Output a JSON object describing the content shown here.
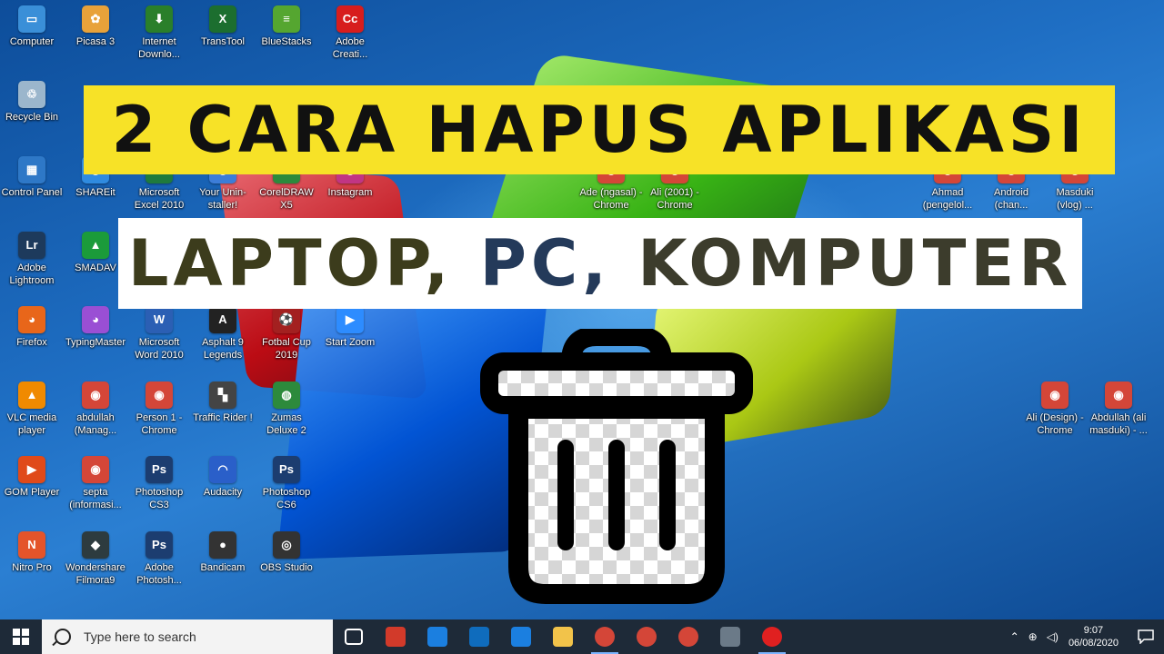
{
  "desktop_icons": [
    {
      "label": "Computer",
      "color": "#3a8fd8",
      "glyph": "▭",
      "icon": "computer-icon"
    },
    {
      "label": "Picasa 3",
      "color": "#e8a23a",
      "glyph": "✿",
      "icon": "picasa-icon"
    },
    {
      "label": "Internet Downlo...",
      "color": "#2a7f2a",
      "glyph": "⬇",
      "icon": "idm-icon"
    },
    {
      "label": "TransTool",
      "color": "#1c6e2f",
      "glyph": "X",
      "icon": "transtool-icon"
    },
    {
      "label": "BlueStacks",
      "color": "#55a630",
      "glyph": "≡",
      "icon": "bluestacks-icon"
    },
    {
      "label": "Adobe Creati...",
      "color": "#d71d1d",
      "glyph": "Cc",
      "icon": "adobe-cc-icon"
    },
    {
      "label": "Recycle Bin",
      "color": "#9bb6cc",
      "glyph": "♲",
      "icon": "recycle-bin-icon"
    },
    {
      "label": "Control Panel",
      "color": "#2e78c7",
      "glyph": "▦",
      "icon": "control-panel-icon"
    },
    {
      "label": "SHAREit",
      "color": "#2f8be0",
      "glyph": "◉",
      "icon": "shareit-icon"
    },
    {
      "label": "Microsoft Excel 2010",
      "color": "#1f7a3d",
      "glyph": "X",
      "icon": "excel-icon"
    },
    {
      "label": "Your Unin-staller!",
      "color": "#3c7dd8",
      "glyph": "◎",
      "icon": "uninstaller-icon"
    },
    {
      "label": "CorelDRAW X5",
      "color": "#2c8a3c",
      "glyph": "◐",
      "icon": "coreldraw-icon"
    },
    {
      "label": "Instagram",
      "color": "#c13584",
      "glyph": "◎",
      "icon": "instagram-icon"
    },
    {
      "label": "Adobe Lightroom",
      "color": "#1d3a5c",
      "glyph": "Lr",
      "icon": "lightroom-icon"
    },
    {
      "label": "SMADAV",
      "color": "#1b9b3a",
      "glyph": "▲",
      "icon": "smadav-icon"
    },
    {
      "label": "Firefox",
      "color": "#e8661a",
      "glyph": "◕",
      "icon": "firefox-icon"
    },
    {
      "label": "TypingMaster",
      "color": "#9a4fd4",
      "glyph": "◕",
      "icon": "typingmaster-icon"
    },
    {
      "label": "Microsoft Word 2010",
      "color": "#2b5fb4",
      "glyph": "W",
      "icon": "word-icon"
    },
    {
      "label": "Asphalt 9 Legends",
      "color": "#222222",
      "glyph": "A",
      "icon": "asphalt-icon"
    },
    {
      "label": "Fotbal Cup 2019",
      "color": "#a32020",
      "glyph": "⚽",
      "icon": "football-icon"
    },
    {
      "label": "Start Zoom",
      "color": "#2d8cff",
      "glyph": "▶",
      "icon": "zoom-icon"
    },
    {
      "label": "VLC media player",
      "color": "#f08a00",
      "glyph": "▲",
      "icon": "vlc-icon"
    },
    {
      "label": "abdullah (Manag...",
      "color": "#d44638",
      "glyph": "◉",
      "icon": "chrome-icon"
    },
    {
      "label": "Person 1 - Chrome",
      "color": "#d44638",
      "glyph": "◉",
      "icon": "chrome-icon"
    },
    {
      "label": "Traffic Rider !",
      "color": "#444444",
      "glyph": "▚",
      "icon": "traffic-rider-icon"
    },
    {
      "label": "Zumas Deluxe 2",
      "color": "#2d8a3c",
      "glyph": "◍",
      "icon": "zuma-icon"
    },
    {
      "label": "GOM Player",
      "color": "#e04a1a",
      "glyph": "▶",
      "icon": "gom-player-icon"
    },
    {
      "label": "septa (informasi...",
      "color": "#d44638",
      "glyph": "◉",
      "icon": "chrome-icon"
    },
    {
      "label": "Photoshop CS3",
      "color": "#1c3d70",
      "glyph": "Ps",
      "icon": "photoshop-icon"
    },
    {
      "label": "Audacity",
      "color": "#2a5fc9",
      "glyph": "◠",
      "icon": "audacity-icon"
    },
    {
      "label": "Photoshop CS6",
      "color": "#1c3d70",
      "glyph": "Ps",
      "icon": "photoshop-icon"
    },
    {
      "label": "Nitro Pro",
      "color": "#e4542a",
      "glyph": "N",
      "icon": "nitro-icon"
    },
    {
      "label": "Wondershare Filmora9",
      "color": "#2d3b3f",
      "glyph": "◆",
      "icon": "filmora-icon"
    },
    {
      "label": "Adobe Photosh...",
      "color": "#1c3d70",
      "glyph": "Ps",
      "icon": "photoshop-icon"
    },
    {
      "label": "Bandicam",
      "color": "#333333",
      "glyph": "●",
      "icon": "bandicam-icon"
    },
    {
      "label": "OBS Studio",
      "color": "#333333",
      "glyph": "◎",
      "icon": "obs-icon"
    },
    {
      "label": "Ade (ngasal) - Chrome",
      "color": "#d44638",
      "glyph": "◉",
      "icon": "chrome-icon"
    },
    {
      "label": "Ali (2001) - Chrome",
      "color": "#d44638",
      "glyph": "◉",
      "icon": "chrome-icon"
    },
    {
      "label": "Ahmad (pengelol...",
      "color": "#d44638",
      "glyph": "◉",
      "icon": "chrome-icon"
    },
    {
      "label": "Android (chan...",
      "color": "#d44638",
      "glyph": "◉",
      "icon": "chrome-icon"
    },
    {
      "label": "Masduki (vlog) ...",
      "color": "#d44638",
      "glyph": "◉",
      "icon": "chrome-icon"
    },
    {
      "label": "Ali (Design) - Chrome",
      "color": "#d44638",
      "glyph": "◉",
      "icon": "chrome-icon"
    },
    {
      "label": "Abdullah (ali masduki) - ...",
      "color": "#d44638",
      "glyph": "◉",
      "icon": "chrome-icon"
    }
  ],
  "banner": {
    "line1": "2 CARA HAPUS APLIKASI",
    "line2_parts": [
      {
        "text": "LAPTOP, ",
        "color": "#3c3c1c"
      },
      {
        "text": "PC, ",
        "color": "#243a5a"
      },
      {
        "text": "KOMPUTER",
        "color": "#3c3c2c"
      }
    ]
  },
  "taskbar": {
    "search_placeholder": "Type here to search",
    "apps": [
      {
        "icon": "task-view-icon",
        "color": "#1e2a38"
      },
      {
        "icon": "screen-recorder-icon",
        "color": "#d23a2a"
      },
      {
        "icon": "edge-icon",
        "color": "#1b7fe0"
      },
      {
        "icon": "store-icon",
        "color": "#0f6cbd"
      },
      {
        "icon": "mail-icon",
        "color": "#1b7fe0"
      },
      {
        "icon": "file-explorer-icon",
        "color": "#f2c34a"
      },
      {
        "icon": "chrome-youtube-icon",
        "color": "#d44638"
      },
      {
        "icon": "chrome-icon",
        "color": "#d44638"
      },
      {
        "icon": "chrome-profile-icon",
        "color": "#d44638"
      },
      {
        "icon": "calculator-icon",
        "color": "#6b7a88"
      },
      {
        "icon": "bandicam-record-icon",
        "color": "#e02020"
      }
    ],
    "time": "9:07",
    "date": "06/08/2020"
  }
}
